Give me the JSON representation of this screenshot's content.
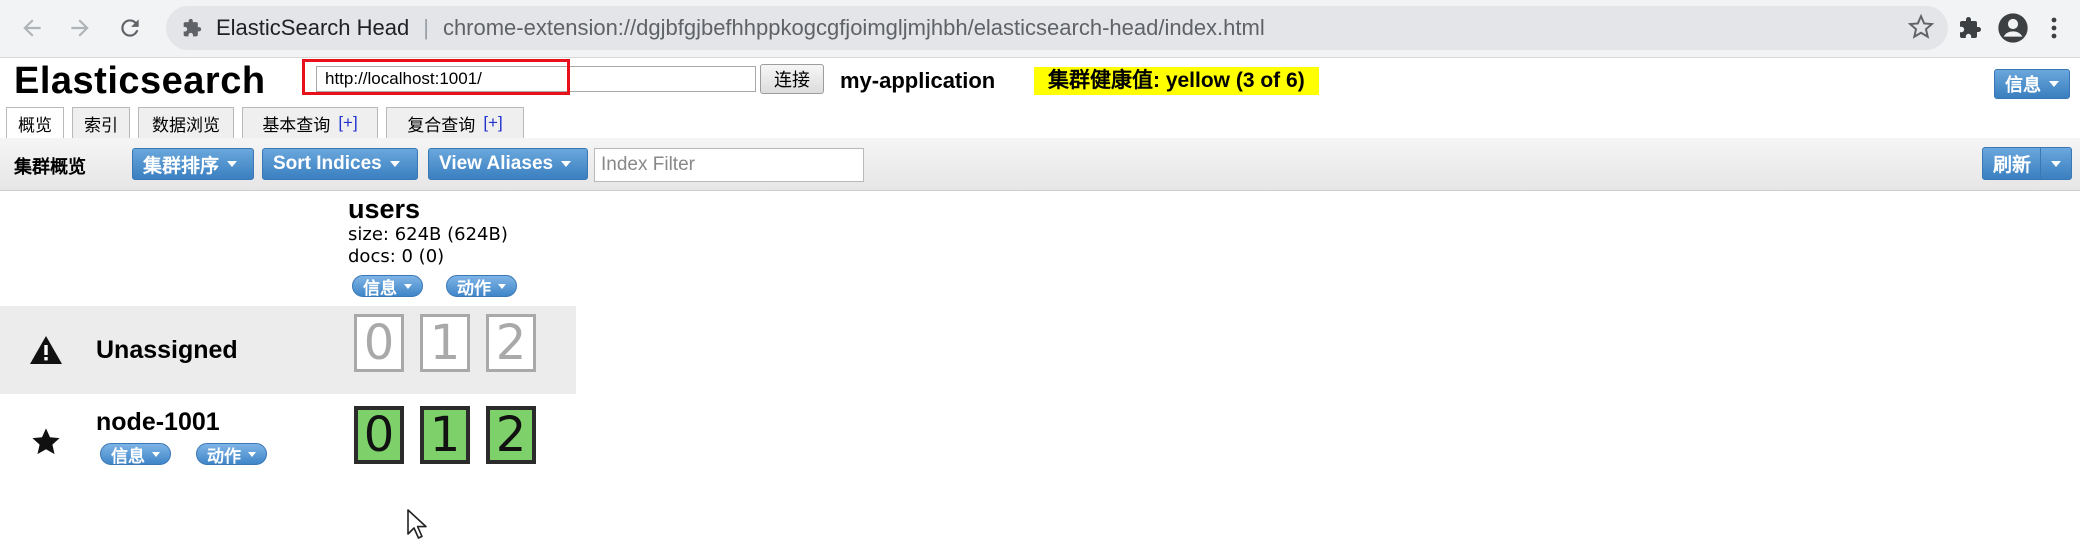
{
  "browser": {
    "tab_title": "ElasticSearch Head",
    "url": "chrome-extension://dgjbfgjbefhhppkogcgfjoimgljmjhbh/elasticsearch-head/index.html",
    "icons": [
      "back-arrow-icon",
      "forward-arrow-icon",
      "reload-icon",
      "puzzle-icon",
      "star-icon",
      "extensions-icon",
      "profile-icon",
      "kebab-menu-icon"
    ]
  },
  "header": {
    "title": "Elasticsearch",
    "connect_url": "http://localhost:1001/",
    "connect_label": "连接",
    "cluster_name": "my-application",
    "health": "集群健康值: yellow (3 of 6)",
    "info_label": "信息"
  },
  "tabs": [
    {
      "label": "概览",
      "active": true
    },
    {
      "label": "索引"
    },
    {
      "label": "数据浏览"
    },
    {
      "label": "基本查询",
      "plus": "[+]"
    },
    {
      "label": "复合查询",
      "plus": "[+]"
    }
  ],
  "toolbar": {
    "title": "集群概览",
    "sort_cluster": "集群排序",
    "sort_indices": "Sort Indices",
    "view_aliases": "View Aliases",
    "filter_placeholder": "Index Filter",
    "refresh": "刷新"
  },
  "index": {
    "name": "users",
    "size": "size: 624B (624B)",
    "docs": "docs: 0 (0)",
    "info_label": "信息",
    "action_label": "动作"
  },
  "rows": {
    "unassigned": {
      "label": "Unassigned",
      "shards": [
        "0",
        "1",
        "2"
      ]
    },
    "node": {
      "label": "node-1001",
      "info_label": "信息",
      "action_label": "动作",
      "shards": [
        "0",
        "1",
        "2"
      ]
    }
  },
  "colors": {
    "health_bg": "#ffff00",
    "primary_btn": "#3a7fc0",
    "highlight_box": "#e8101a",
    "shard_green": "#7ed06a"
  }
}
